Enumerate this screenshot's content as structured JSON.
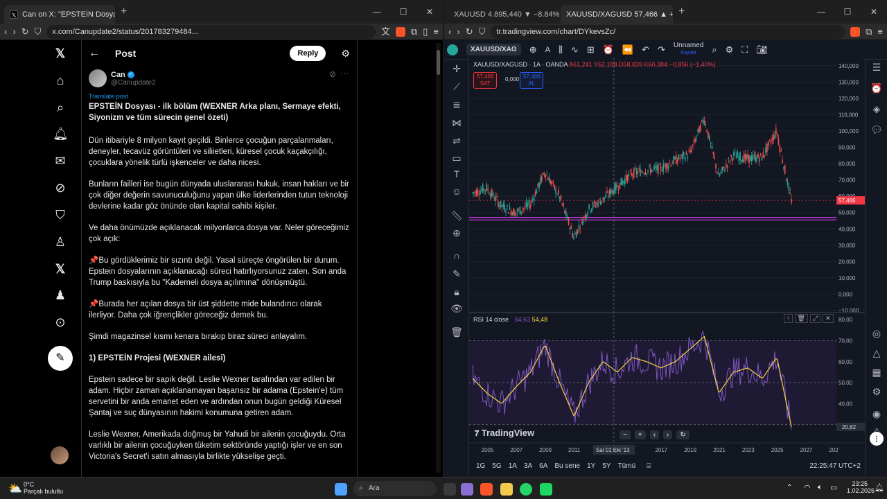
{
  "left_browser": {
    "tab_title": "Can on X: \"EPSTEİN Dosyası - ilk",
    "url": "x.com/Canupdate2/status/201783279484..."
  },
  "right_browser": {
    "tab1_title": "XAUUSD 4.895,440 ▼ −8.84% Unnam",
    "tab2_title": "XAUUSD/XAGUSD 57,466 ▲ +2",
    "url": "tr.tradingview.com/chart/DYkevsZc/"
  },
  "x_post": {
    "header": "Post",
    "reply_label": "Reply",
    "author_name": "Can",
    "author_handle": "@Canupdate2",
    "translate_label": "Translate post",
    "title": "EPSTEİN Dosyası - ilk bölüm (WEXNER Arka planı, Sermaye efekti, Siyonizm ve tüm sürecin genel özeti)",
    "paragraphs": [
      {
        "text": "Dün itibariyle 8 milyon kayıt geçildi. Binlerce çocuğun parçalanmaları, deneyler, tecavüz görüntüleri ve siliietleri, küresel çocuk kaçakçılığı, çocuklara yönelik türlü işkenceler ve daha nicesi.",
        "bold": false
      },
      {
        "text": "Bunların failleri ise bugün dünyada uluslararası hukuk, insan hakları ve bir çok diğer değerin savunuculuğunu yapan ülke liderlerinden tutun teknoloji devlerine kadar göz önünde olan kapital sahibi kişiler.",
        "bold": false
      },
      {
        "text": "Ve daha önümüzde açıklanacak milyonlarca dosya var. Neler göreceğimiz çok açık:",
        "bold": false
      },
      {
        "text": "📌Bu gördüklerimiz bir sızıntı değil. Yasal süreçte öngörülen bir durum. Epstein dosyalarının açıklanacağı süreci hatırlıyorsunuz zaten. Son anda Trump baskısıyla bu \"Kademeli dosya açılımına\" dönüşmüştü.",
        "bold": false
      },
      {
        "text": "📌Burada her açılan dosya bir üst şiddette mide bulandırıcı olarak ilerliyor. Daha çok iğrençlikler göreceğiz demek bu.",
        "bold": false
      },
      {
        "text": "Şimdi magazinsel kısmı kenara bırakıp biraz süreci anlayalım.",
        "bold": false
      },
      {
        "text": "1) EPSTEİN Projesi (WEXNER ailesi)",
        "bold": true
      },
      {
        "text": "Epstein sadece bir sapık değil. Leslie Wexner tarafından var edilen bir adam. Hiçbir zaman açıklanamayan başarısız bir adama (Epstein'e) tüm servetini bir anda emanet eden ve ardından onun bugün geldiği Küresel Şantaj ve suç dünyasının hakimi konumuna getiren adam.",
        "bold": false
      },
      {
        "text": " Leslie Wexner, Amerikada doğmuş bir Yahudi bir ailenin çocuğuydu. Orta varlıklı bir ailenin çocuğuyken tüketim sektöründe yaptığı işler ve en son Victoria's Secret'i satın almasıyla birlikte yükselişe geçti.",
        "bold": false
      }
    ]
  },
  "tradingview": {
    "symbol": "XAUUSD/XAG",
    "layout_name": "Unnamed",
    "layout_status": "Kaydet",
    "legend_symbol": "XAUUSD/XAGUSD · 1A · OANDA",
    "legend_o": "A61,241",
    "legend_h": "Y62,188",
    "legend_l": "D58,839",
    "legend_c": "K60,384",
    "legend_change": "−0,856 (−1,40%)",
    "sell_price": "57,466",
    "sell_label": "SAT",
    "spread": "0,000",
    "buy_price": "57,466",
    "buy_label": "AL",
    "price_tag": "57,466",
    "rsi_label": "RSI 14 close",
    "rsi_val1": "54,63",
    "rsi_val2": "54,48",
    "rsi_tag": "20,82",
    "crosshair_date": "Sal 01 Eki '13",
    "watermark": "TradingView",
    "timeframes": [
      "1G",
      "5G",
      "1A",
      "3A",
      "6A",
      "Bu sene",
      "1Y",
      "5Y",
      "Tümü"
    ],
    "clock": "22:25:47 UTC+2",
    "price_axis": [
      "140,000",
      "130,000",
      "120,000",
      "110,000",
      "100,000",
      "90,000",
      "80,000",
      "70,000",
      "60,000",
      "50,000",
      "40,000",
      "30,000",
      "20,000",
      "10,000",
      "0,000",
      "−10,000"
    ],
    "rsi_axis": [
      "80,00",
      "70,00",
      "60,00",
      "50,00",
      "40,00",
      "30,00"
    ],
    "time_axis": [
      "2005",
      "2007",
      "2009",
      "2011",
      "5",
      "2017",
      "2019",
      "2021",
      "2023",
      "2025",
      "2027",
      "202"
    ]
  },
  "chart_data": {
    "type": "line",
    "title": "XAUUSD/XAGUSD · 1A · OANDA",
    "x": [
      2004,
      2005,
      2006,
      2007,
      2008,
      2009,
      2010,
      2011,
      2012,
      2013,
      2014,
      2015,
      2016,
      2017,
      2018,
      2019,
      2020,
      2021,
      2022,
      2023,
      2024,
      2025,
      2026
    ],
    "series": [
      {
        "name": "XAUUSD/XAGUSD",
        "values": [
          62,
          65,
          54,
          50,
          55,
          75,
          60,
          35,
          52,
          58,
          66,
          74,
          76,
          77,
          82,
          86,
          108,
          72,
          85,
          83,
          84,
          100,
          57.5
        ]
      },
      {
        "name": "RSI 14 close",
        "values": [
          52,
          45,
          40,
          48,
          55,
          68,
          50,
          34,
          50,
          60,
          55,
          62,
          60,
          57,
          60,
          66,
          72,
          45,
          55,
          57,
          52,
          62,
          29
        ]
      }
    ],
    "ylim": [
      -10,
      145
    ],
    "rsi_ylim": [
      25,
      82
    ],
    "horizontal_lines": [
      45.5,
      47.0
    ]
  },
  "taskbar": {
    "weather_temp": "0°C",
    "weather_desc": "Parçalı bulutlu",
    "search_label": "Ara",
    "time": "23:25",
    "date": "1.02.2026"
  }
}
